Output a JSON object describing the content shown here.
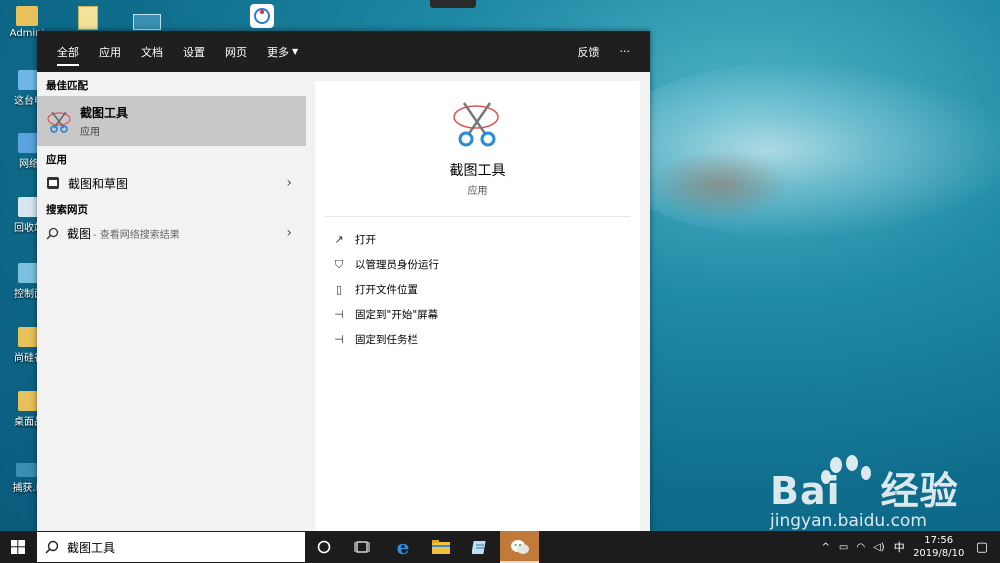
{
  "desktop": {
    "icons": [
      {
        "label": "Admini"
      },
      {
        "label": "这台电"
      },
      {
        "label": "网络"
      },
      {
        "label": "回收站"
      },
      {
        "label": "控制面"
      },
      {
        "label": "尚硅谷"
      },
      {
        "label": "桌面品"
      },
      {
        "label": "捕获.P"
      }
    ],
    "watermark": {
      "brand": "Bai",
      "brand2": "经验",
      "url": "jingyan.baidu.com"
    }
  },
  "tabs": {
    "all": "全部",
    "apps": "应用",
    "docs": "文档",
    "settings": "设置",
    "web": "网页",
    "more": "更多",
    "feedback": "反馈",
    "ellipsis": "···"
  },
  "left": {
    "best_match_header": "最佳匹配",
    "best_match": {
      "name": "截图工具",
      "type": "应用"
    },
    "apps_header": "应用",
    "app_item": "截图和草图",
    "web_header": "搜索网页",
    "web_item": {
      "query": "截图",
      "suffix": "- 查看网络搜索结果"
    }
  },
  "right": {
    "title": "截图工具",
    "subtitle": "应用",
    "actions": [
      {
        "label": "打开",
        "icon": "open-icon"
      },
      {
        "label": "以管理员身份运行",
        "icon": "admin-shield-icon"
      },
      {
        "label": "打开文件位置",
        "icon": "file-location-icon"
      },
      {
        "label": "固定到\"开始\"屏幕",
        "icon": "pin-icon"
      },
      {
        "label": "固定到任务栏",
        "icon": "pin-icon"
      }
    ]
  },
  "taskbar": {
    "search_value": "截图工具",
    "ime": "中",
    "time": "17:56",
    "date": "2019/8/10"
  }
}
